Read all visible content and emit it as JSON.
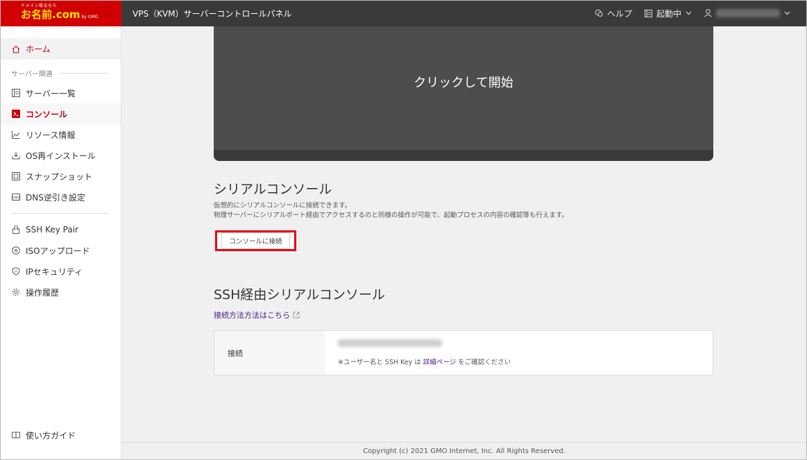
{
  "header": {
    "logo_tagline": "ドメイン取るなら",
    "logo_text": "お名前.com",
    "logo_sub": "by GMO",
    "app_title": "VPS（KVM）サーバーコントロールパネル",
    "help_label": "ヘルプ",
    "status_label": "起動中"
  },
  "sidebar": {
    "home": "ホーム",
    "section_server": "サーバー関連",
    "items": [
      {
        "label": "サーバー一覧",
        "icon": "list-icon"
      },
      {
        "label": "コンソール",
        "icon": "terminal-icon"
      },
      {
        "label": "リソース情報",
        "icon": "chart-icon"
      },
      {
        "label": "OS再インストール",
        "icon": "download-icon"
      },
      {
        "label": "スナップショット",
        "icon": "snapshot-icon"
      },
      {
        "label": "DNS逆引き設定",
        "icon": "dns-icon"
      }
    ],
    "items2": [
      {
        "label": "SSH Key Pair",
        "icon": "lock-icon"
      },
      {
        "label": "ISOアップロード",
        "icon": "disc-icon"
      },
      {
        "label": "IPセキュリティ",
        "icon": "shield-icon"
      },
      {
        "label": "操作履歴",
        "icon": "gear-icon"
      }
    ],
    "guide": "使い方ガイド"
  },
  "main": {
    "console_start": "クリックして開始",
    "serial_title": "シリアルコンソール",
    "serial_desc1": "仮想的にシリアルコンソールに接続できます。",
    "serial_desc2": "物理サーバーにシリアルポート経由でアクセスするのと同様の操作が可能で、起動プロセスの内容の確認等も行えます。",
    "connect_button": "コンソールに接続",
    "ssh_title": "SSH経由シリアルコンソール",
    "help_link": "接続方法方法はこちら",
    "table_header": "接続",
    "note_prefix": "※ユーザー名と SSH Key は",
    "note_link": "詳細ページ",
    "note_suffix": "をご確認ください"
  },
  "footer": {
    "copyright": "Copyright (c) 2021 GMO Internet, Inc. All Rights Reserved."
  },
  "colors": {
    "brand_red": "#d10000",
    "accent_red": "#c3000a",
    "highlight": "#e60012",
    "link_purple": "#4a148c",
    "header_bg": "#3a3a3a"
  }
}
